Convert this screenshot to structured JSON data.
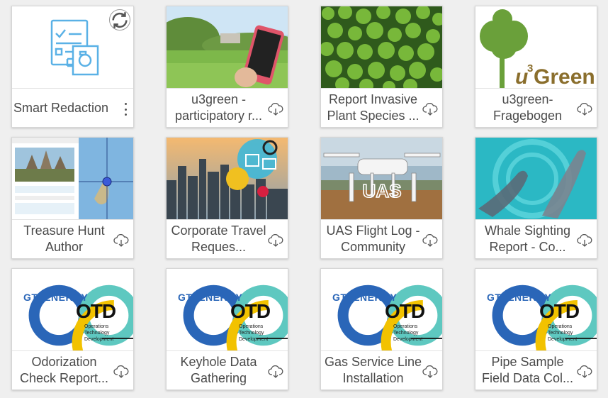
{
  "items": [
    {
      "title": "Smart Redaction"
    },
    {
      "title": "u3green - participatory r..."
    },
    {
      "title": "Report Invasive Plant Species ..."
    },
    {
      "title": "u3green-Fragebogen"
    },
    {
      "title": "Treasure Hunt Author"
    },
    {
      "title": "Corporate Travel Reques..."
    },
    {
      "title": "UAS Flight Log - Community"
    },
    {
      "title": "Whale Sighting Report  - Co..."
    },
    {
      "title": "Odorization Check Report..."
    },
    {
      "title": "Keyhole Data Gathering"
    },
    {
      "title": "Gas Service Line Installation"
    },
    {
      "title": "Pipe Sample Field Data Col..."
    }
  ],
  "thumb_text": {
    "u3green_logo": "u",
    "u3green_sup": "3",
    "u3green_word": "Green",
    "uas": "UAS",
    "gti": "GTI ENERGY",
    "otd": "OTD",
    "otd_line1": "Operations",
    "otd_line2": "Technology",
    "otd_line3": "Development"
  },
  "colors": {
    "accent": "#2a66b8",
    "otd_yellow": "#f2c200",
    "icon_blue": "#5ab1e6"
  }
}
